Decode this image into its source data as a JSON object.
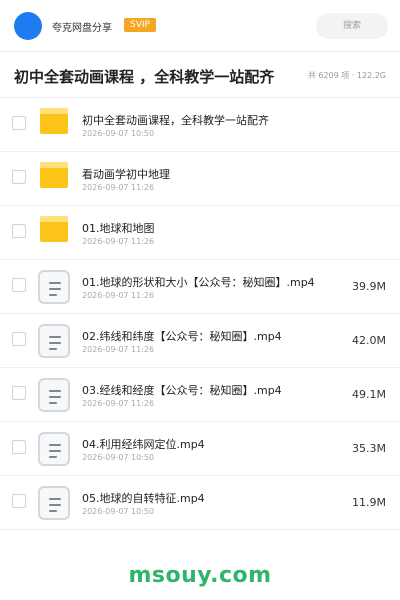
{
  "header": {
    "app_name": "夸克网盘分享",
    "badge": "SVIP",
    "search_placeholder": "搜索"
  },
  "title_bar": {
    "title": "初中全套动画课程 ，全科教学一站配齐",
    "meta": "共 6209 项 · 122.2G"
  },
  "files": [
    {
      "type": "folder",
      "name": "初中全套动画课程，全科教学一站配齐",
      "date": "2026-09-07 10:50",
      "size": ""
    },
    {
      "type": "folder",
      "name": "看动画学初中地理",
      "date": "2026-09-07 11:26",
      "size": ""
    },
    {
      "type": "folder",
      "name": "01.地球和地图",
      "date": "2026-09-07 11:26",
      "size": ""
    },
    {
      "type": "file",
      "name": "01.地球的形状和大小【公众号：秘知圈】.mp4",
      "date": "2026-09-07 11:26",
      "size": "39.9M"
    },
    {
      "type": "file",
      "name": "02.纬线和纬度【公众号：秘知圈】.mp4",
      "date": "2026-09-07 11:26",
      "size": "42.0M"
    },
    {
      "type": "file",
      "name": "03.经线和经度【公众号：秘知圈】.mp4",
      "date": "2026-09-07 11:26",
      "size": "49.1M"
    },
    {
      "type": "file",
      "name": "04.利用经纬网定位.mp4",
      "date": "2026-09-07 10:50",
      "size": "35.3M"
    },
    {
      "type": "file",
      "name": "05.地球的自转特征.mp4",
      "date": "2026-09-07 10:50",
      "size": "11.9M"
    }
  ],
  "watermark": "msouy.com"
}
